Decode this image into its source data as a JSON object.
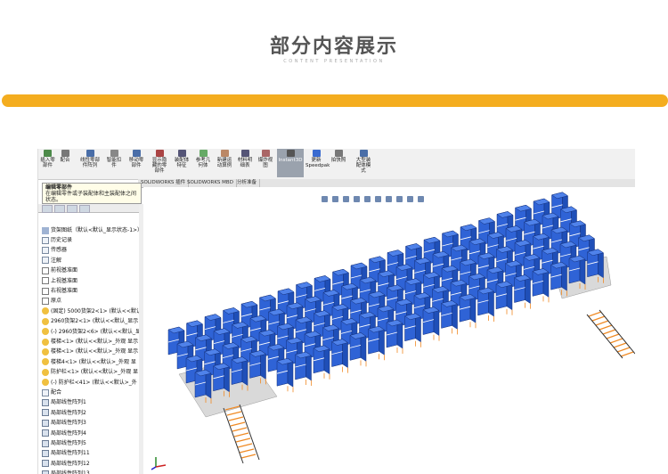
{
  "slide": {
    "title": "部分内容展示",
    "subtitle": "CONTENT PRESENTATION",
    "accent_color": "#f4ad1f"
  },
  "toolbar": {
    "buttons": [
      {
        "label": "插入零\n部件",
        "icon": "insert-component-icon"
      },
      {
        "label": "配合",
        "icon": "mate-icon"
      },
      {
        "label": "线性零部\n件阵列",
        "icon": "linear-pattern-icon"
      },
      {
        "label": "智能扣\n件",
        "icon": "smart-fastener-icon"
      },
      {
        "label": "移动零\n部件",
        "icon": "move-component-icon"
      },
      {
        "label": "显示隐\n藏的零\n部件",
        "icon": "show-hidden-icon"
      },
      {
        "label": "装配体\n特征",
        "icon": "assembly-feature-icon"
      },
      {
        "label": "参考几\n何体",
        "icon": "reference-geometry-icon"
      },
      {
        "label": "新建运\n动算例",
        "icon": "motion-study-icon"
      },
      {
        "label": "材料明\n细表",
        "icon": "bom-icon"
      },
      {
        "label": "爆炸视\n图",
        "icon": "exploded-view-icon"
      },
      {
        "label": "Instant3D",
        "icon": "instant3d-icon"
      },
      {
        "label": "更新\nSpeedpak",
        "icon": "speedpak-icon"
      },
      {
        "label": "拍快照",
        "icon": "snapshot-icon"
      },
      {
        "label": "大型装\n配体模\n式",
        "icon": "large-assembly-icon"
      }
    ]
  },
  "tabs": [
    "SOLIDWORKS 插件",
    "SOLIDWORKS MBD",
    "分析准备"
  ],
  "tooltip": {
    "title": "编辑零部件",
    "body": "在编辑零件或子装配体和主装配体之间状态。"
  },
  "tree": {
    "root": "货架图纸（默认<默认_显示状态-1>）",
    "items": [
      {
        "label": "历史记录",
        "icon": "history-icon",
        "kind": "doc"
      },
      {
        "label": "传感器",
        "icon": "sensor-icon",
        "kind": "doc"
      },
      {
        "label": "注解",
        "icon": "annotation-icon",
        "kind": "doc"
      },
      {
        "label": "前视基准面",
        "icon": "plane-icon",
        "kind": "plane"
      },
      {
        "label": "上视基准面",
        "icon": "plane-icon",
        "kind": "plane"
      },
      {
        "label": "右视基准面",
        "icon": "plane-icon",
        "kind": "plane"
      },
      {
        "label": "原点",
        "icon": "origin-icon",
        "kind": "plane"
      },
      {
        "label": "(固定) 5000货架2<1> (默认<<默认",
        "icon": "part-icon",
        "kind": "part"
      },
      {
        "label": "2960货架2<1> (默认<<默认_显示",
        "icon": "part-icon",
        "kind": "part"
      },
      {
        "label": "(-) 2960货架2<6> (默认<<默认_显",
        "icon": "part-icon",
        "kind": "part"
      },
      {
        "label": "楼梯<1> (默认<<默认>_外观 显示",
        "icon": "part-icon",
        "kind": "part"
      },
      {
        "label": "楼梯<1> (默认<<默认>_外观 显示",
        "icon": "part-icon",
        "kind": "part"
      },
      {
        "label": "楼梯4<1> (默认<<默认>_外观 显",
        "icon": "part-icon",
        "kind": "part"
      },
      {
        "label": "防护栏<1> (默认<<默认>_外观 显",
        "icon": "part-icon",
        "kind": "part"
      },
      {
        "label": "(-) 防护栏<41> (默认<<默认>_外",
        "icon": "part-icon",
        "kind": "part"
      },
      {
        "label": "配合",
        "icon": "mate-icon",
        "kind": "doc"
      },
      {
        "label": "局部线性阵列1",
        "icon": "pattern-icon",
        "kind": "arr"
      },
      {
        "label": "局部线性阵列2",
        "icon": "pattern-icon",
        "kind": "arr"
      },
      {
        "label": "局部线性阵列3",
        "icon": "pattern-icon",
        "kind": "arr"
      },
      {
        "label": "局部线性阵列4",
        "icon": "pattern-icon",
        "kind": "arr"
      },
      {
        "label": "局部线性阵列5",
        "icon": "pattern-icon",
        "kind": "arr"
      },
      {
        "label": "局部线性阵列11",
        "icon": "pattern-icon",
        "kind": "arr"
      },
      {
        "label": "局部线性阵列12",
        "icon": "pattern-icon",
        "kind": "arr"
      },
      {
        "label": "局部线性阵列13",
        "icon": "pattern-icon",
        "kind": "arr"
      }
    ]
  },
  "model": {
    "rack_color": "#2f63d6",
    "rack_edge": "#14307a",
    "frame_color": "#f08a24",
    "platform_color": "#d9d9d9"
  }
}
